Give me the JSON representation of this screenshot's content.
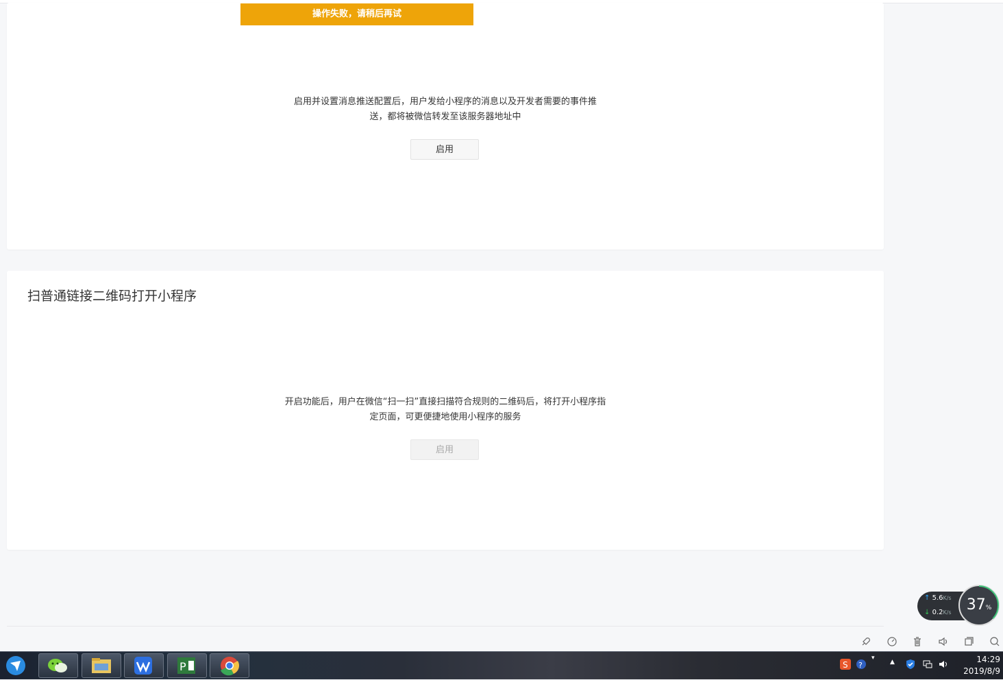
{
  "toast": {
    "message": "操作失败，请稍后再试"
  },
  "message_push": {
    "description_line1": "启用并设置消息推送配置后，用户发给小程序的消息以及开发者需要的事件推",
    "description_line2": "送，都将被微信转发至该服务器地址中",
    "enable_label": "启用"
  },
  "qrcode_section": {
    "title": "扫普通链接二维码打开小程序",
    "description_line1": "开启功能后，用户在微信“扫一扫”直接扫描符合规则的二维码后，将打开小程序指",
    "description_line2": "定页面，可更便捷地使用小程序的服务",
    "enable_label": "启用"
  },
  "network_monitor": {
    "upload": "5.6",
    "upload_unit": "K/s",
    "download": "0.2",
    "download_unit": "K/s",
    "percent": "37",
    "percent_unit": "%"
  },
  "taskbar": {
    "time": "14:29",
    "date": "2019/8/9",
    "apps": [
      "start-icon",
      "wechat-icon",
      "file-explorer-icon",
      "wps-icon",
      "project-icon",
      "chrome-icon"
    ]
  }
}
